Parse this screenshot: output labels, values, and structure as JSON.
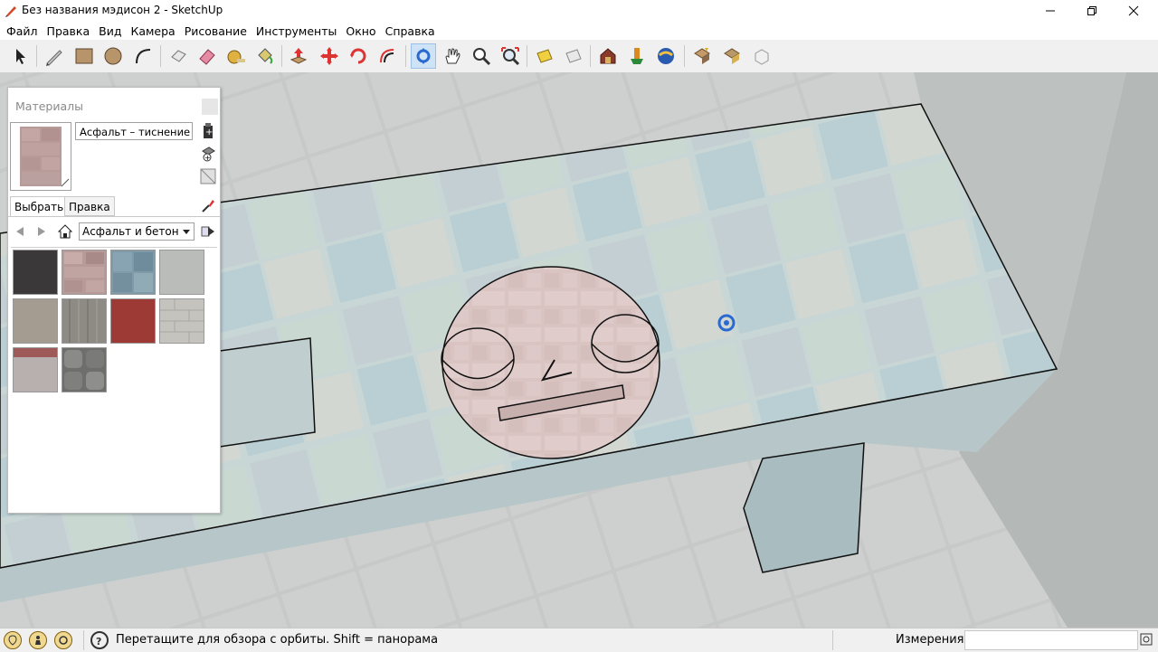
{
  "window": {
    "title": "Без названия мэдисон 2 - SketchUp"
  },
  "menu": [
    {
      "label": "Файл"
    },
    {
      "label": "Правка"
    },
    {
      "label": "Вид"
    },
    {
      "label": "Камера"
    },
    {
      "label": "Рисование"
    },
    {
      "label": "Инструменты"
    },
    {
      "label": "Окно"
    },
    {
      "label": "Справка"
    }
  ],
  "toolbar": {
    "tools": [
      "select-tool",
      "line-tool",
      "rectangle-tool",
      "circle-tool",
      "arc-tool",
      "eraser-tool",
      "paint-bucket-tool",
      "tape-measure-tool",
      "push-pull-tool",
      "move-tool",
      "rotate-tool",
      "offset-tool",
      "orbit-tool",
      "pan-tool",
      "zoom-tool",
      "zoom-extents-tool",
      "section-plane-tool",
      "section-display-tool",
      "warehouse-tool",
      "extension-warehouse-tool",
      "share-model-tool",
      "components-tool",
      "layout-tool",
      "ruby-tool"
    ],
    "active_tool": "orbit-tool"
  },
  "materials_panel": {
    "title": "Материалы",
    "current_material": "Асфальт – тиснение бр",
    "tabs": [
      {
        "label": "Выбрать",
        "active": true
      },
      {
        "label": "Правка",
        "active": false
      }
    ],
    "library": "Асфальт и бетон",
    "swatches": [
      {
        "name": "asphalt-dark",
        "color": "#3a3839"
      },
      {
        "name": "brick-paver-pink",
        "color": "#b89a98"
      },
      {
        "name": "tile-blue",
        "color": "#7f9aa8"
      },
      {
        "name": "concrete-light",
        "color": "#b9bcb8"
      },
      {
        "name": "aggregate-tan",
        "color": "#a59c91"
      },
      {
        "name": "concrete-form-lines",
        "color": "#8e8a84"
      },
      {
        "name": "asphalt-red",
        "color": "#9e3a35"
      },
      {
        "name": "concrete-block-light",
        "color": "#c4c3bd"
      },
      {
        "name": "brick-red-strip",
        "color": "#a88f8d"
      },
      {
        "name": "stone-cobble-gray",
        "color": "#6e6e6c"
      }
    ]
  },
  "statusbar": {
    "hint": "Перетащите для обзора с орбиты.  Shift = панорама",
    "measurements_label": "Измерения",
    "measurements_value": ""
  }
}
